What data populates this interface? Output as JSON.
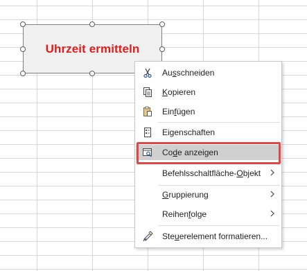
{
  "button": {
    "label": "Uhrzeit ermitteln",
    "label_color": "#e31b1b",
    "fill_color": "#f0f0f0"
  },
  "context_menu": {
    "items": [
      {
        "label": "Ausschneiden",
        "icon": "scissors-icon",
        "accelerator": "s",
        "has_submenu": false
      },
      {
        "label": "Kopieren",
        "icon": "copy-icon",
        "accelerator": "K",
        "has_submenu": false
      },
      {
        "label": "Einfügen",
        "icon": "paste-icon",
        "accelerator": "f",
        "has_submenu": false
      },
      {
        "label": "Eigenschaften",
        "icon": "properties-icon",
        "accelerator": "g",
        "has_submenu": false
      },
      {
        "label": "Code anzeigen",
        "icon": "view-code-icon",
        "accelerator": "d",
        "has_submenu": false,
        "highlighted": true
      },
      {
        "label": "Befehlsschaltfläche-Objekt",
        "icon": "",
        "accelerator": "O",
        "has_submenu": true
      },
      {
        "label": "Gruppierung",
        "icon": "",
        "accelerator": "G",
        "has_submenu": true
      },
      {
        "label": "Reihenfolge",
        "icon": "",
        "accelerator": "f",
        "has_submenu": true
      },
      {
        "label": "Steuerelement formatieren...",
        "icon": "format-control-icon",
        "accelerator": "u",
        "has_submenu": false
      }
    ]
  },
  "colors": {
    "highlight_border": "#e04848",
    "highlight_fill": "#d0d0d0",
    "grid_line": "#d9d9d9"
  }
}
